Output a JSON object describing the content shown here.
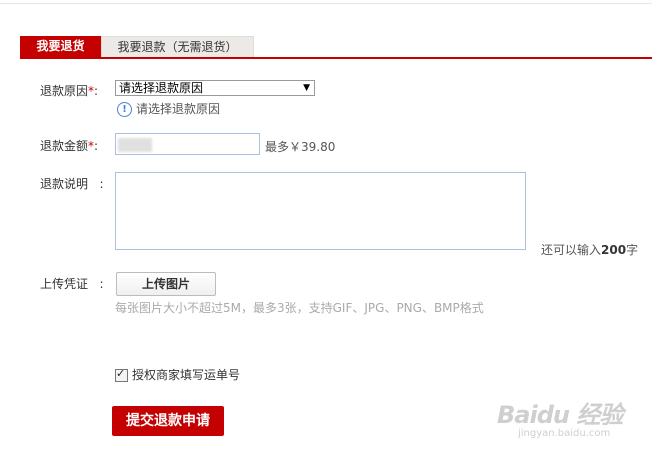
{
  "tabs": {
    "active": "我要退货",
    "inactive": "我要退款（无需退货）"
  },
  "form": {
    "reason_label": "退款原因",
    "required_mark": "*",
    "colon": ":",
    "reason_selected": "请选择退款原因",
    "reason_hint": "请选择退款原因",
    "amount_label": "退款金额",
    "amount_max": "最多￥39.80",
    "desc_label": "退款说明",
    "char_hint_prefix": "还可以输入",
    "char_hint_count": "200",
    "char_hint_suffix": "字",
    "upload_label": "上传凭证",
    "upload_button": "上传图片",
    "upload_note": "每张图片大小不超过5M，最多3张，支持GIF、JPG、PNG、BMP格式",
    "authorize_label": "授权商家填写运单号",
    "authorize_checked": true,
    "submit_button": "提交退款申请"
  },
  "watermark": {
    "logo": "Baidu 经验",
    "url": "jingyan.baidu.com"
  },
  "colors": {
    "accent": "#c40000",
    "inactive_tab": "#ece9e6",
    "input_border": "#a8c2df"
  }
}
